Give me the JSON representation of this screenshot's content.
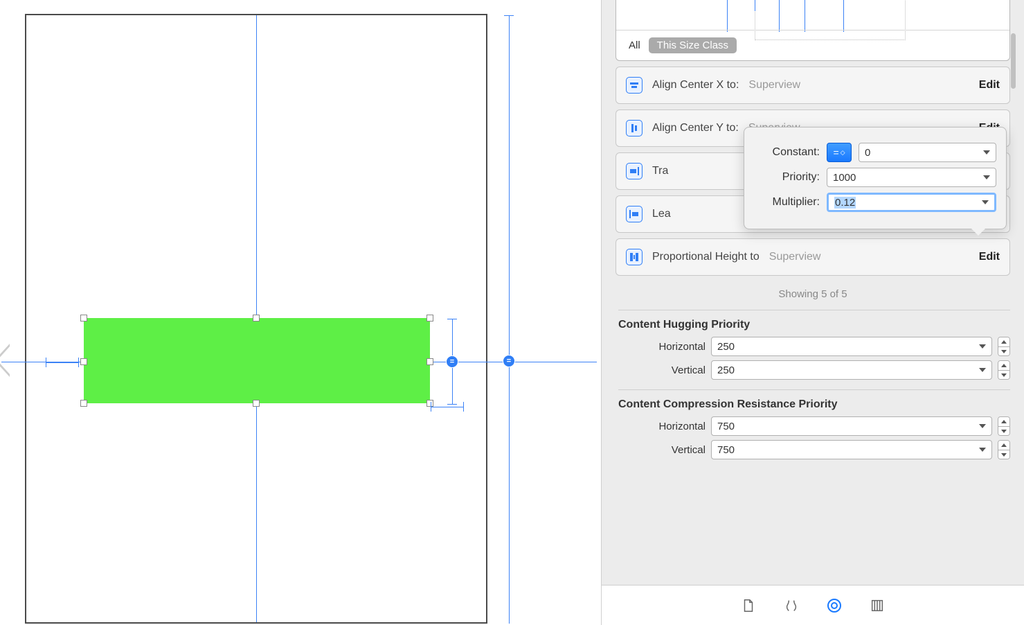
{
  "filter": {
    "all_label": "All",
    "this_size_class_label": "This Size Class"
  },
  "constraints": {
    "center_x": {
      "label": "Align Center X to:",
      "target": "Superview",
      "edit_label": "Edit"
    },
    "center_y": {
      "label": "Align Center Y to:",
      "target": "Superview",
      "edit_label": "Edit"
    },
    "trailing": {
      "label_prefix": "Tra"
    },
    "leading": {
      "label_prefix": "Lea"
    },
    "prop_height": {
      "label": "Proportional Height to",
      "target": "Superview",
      "edit_label": "Edit"
    }
  },
  "popover": {
    "constant_label": "Constant:",
    "relation_value": "=",
    "constant_value": "0",
    "priority_label": "Priority:",
    "priority_value": "1000",
    "multiplier_label": "Multiplier:",
    "multiplier_value": "0.12"
  },
  "showing_text": "Showing 5 of 5",
  "content_hugging": {
    "title": "Content Hugging Priority",
    "horizontal_label": "Horizontal",
    "horizontal_value": "250",
    "vertical_label": "Vertical",
    "vertical_value": "250"
  },
  "compression": {
    "title": "Content Compression Resistance Priority",
    "horizontal_label": "Horizontal",
    "horizontal_value": "750",
    "vertical_label": "Vertical",
    "vertical_value": "750"
  },
  "badge_equals": "="
}
